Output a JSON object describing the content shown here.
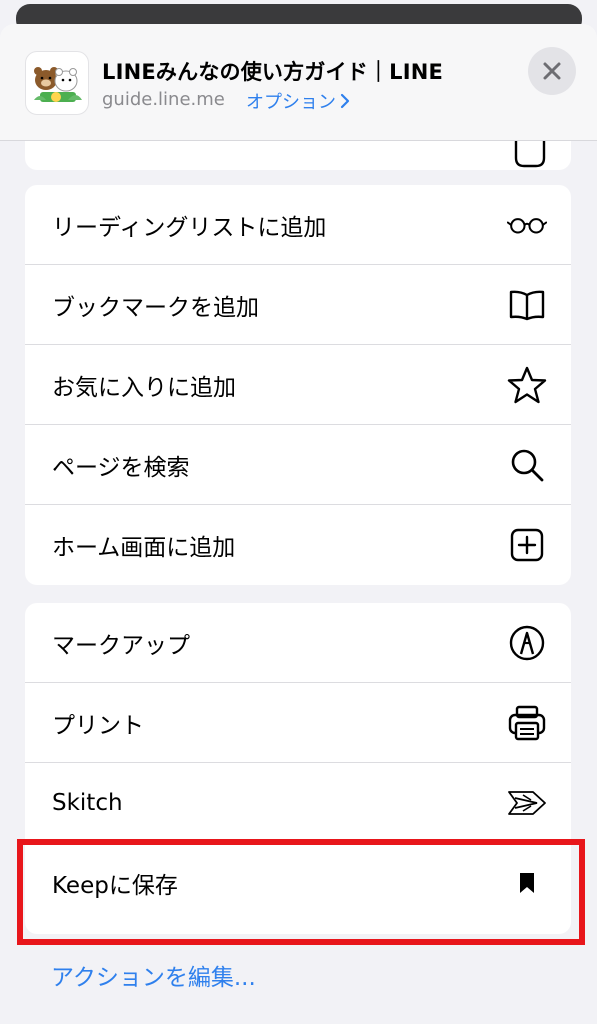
{
  "header": {
    "title": "LINEみんなの使い方ガイド｜LINE",
    "domain": "guide.line.me",
    "option_label": "オプション",
    "close_icon": "close-icon"
  },
  "groups": [
    {
      "items": [
        {
          "label": "リーディングリストに追加",
          "icon": "glasses-icon"
        },
        {
          "label": "ブックマークを追加",
          "icon": "book-icon"
        },
        {
          "label": "お気に入りに追加",
          "icon": "star-icon"
        },
        {
          "label": "ページを検索",
          "icon": "search-icon"
        },
        {
          "label": "ホーム画面に追加",
          "icon": "add-square-icon"
        }
      ]
    },
    {
      "items": [
        {
          "label": "マークアップ",
          "icon": "markup-pen-icon"
        },
        {
          "label": "プリント",
          "icon": "printer-icon"
        },
        {
          "label": "Skitch",
          "icon": "skitch-arrow-icon"
        },
        {
          "label": "Keepに保存",
          "icon": "bookmark-icon"
        }
      ]
    }
  ],
  "footer": {
    "edit_actions": "アクションを編集..."
  },
  "colors": {
    "accent": "#2f80ed",
    "highlight": "#e8161b",
    "background": "#f2f2f6"
  }
}
